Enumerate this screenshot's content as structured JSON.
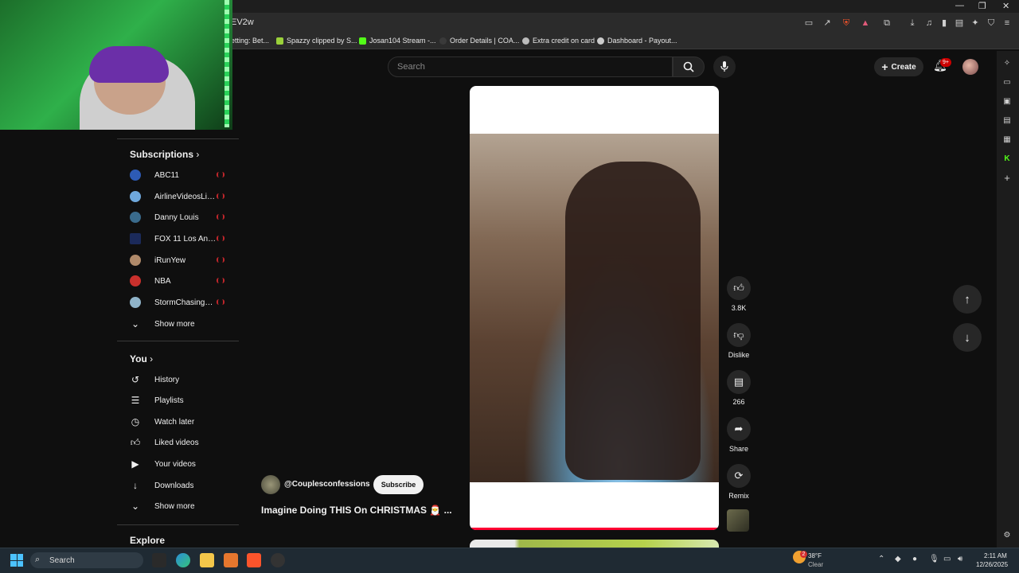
{
  "browser": {
    "url_fragment": "EV2w",
    "bookmarks": [
      {
        "label": "etting: Bet...",
        "color": "#888888"
      },
      {
        "label": "Spazzy clipped by S...",
        "color": "#9ad13a"
      },
      {
        "label": "Josan104 Stream -...",
        "color": "#53fc18"
      },
      {
        "label": "Order Details | COA...",
        "color": "#3a3a3a"
      },
      {
        "label": "Extra credit on card",
        "color": "#bbbbbb"
      },
      {
        "label": "Dashboard - Payout...",
        "color": "#cccccc"
      }
    ]
  },
  "header": {
    "search_placeholder": "Search",
    "create_label": "Create",
    "notification_count": "9+"
  },
  "sidebar": {
    "subscriptions_heading": "Subscriptions",
    "subscriptions": [
      {
        "label": "ABC11",
        "color": "#2d5bb5"
      },
      {
        "label": "AirlineVideosLive+",
        "color": "#6fa8dc"
      },
      {
        "label": "Danny Louis",
        "color": "#3a6b8c"
      },
      {
        "label": "FOX 11 Los Ang...",
        "color": "#1b2a5a"
      },
      {
        "label": "iRunYew",
        "color": "#b08a6a"
      },
      {
        "label": "NBA",
        "color": "#c9302c"
      },
      {
        "label": "StormChasingVi...",
        "color": "#8fb3c9"
      }
    ],
    "show_more_1": "Show more",
    "you_heading": "You",
    "you_items": [
      {
        "label": "History",
        "icon": "history-icon",
        "glyph": "↺"
      },
      {
        "label": "Playlists",
        "icon": "playlist-icon",
        "glyph": "☰"
      },
      {
        "label": "Watch later",
        "icon": "clock-icon",
        "glyph": "◷"
      },
      {
        "label": "Liked videos",
        "icon": "thumbs-up-icon",
        "glyph": "👍"
      },
      {
        "label": "Your videos",
        "icon": "video-icon",
        "glyph": "▶"
      },
      {
        "label": "Downloads",
        "icon": "download-icon",
        "glyph": "↓"
      }
    ],
    "show_more_2": "Show more",
    "explore_heading": "Explore"
  },
  "short": {
    "channel": "@Couplesconfessions",
    "subscribe_label": "Subscribe",
    "title": "Imagine Doing THIS On CHRISTMAS 🎅 ...",
    "likes": "3.8K",
    "dislike_label": "Dislike",
    "comments": "266",
    "share_label": "Share",
    "remix_label": "Remix"
  },
  "taskbar": {
    "search_placeholder": "Search",
    "weather_temp": "38°F",
    "weather_cond": "Clear",
    "weather_badge": "2",
    "time": "2:11 AM",
    "date": "12/26/2025"
  },
  "colors": {
    "live_indicator": "#c0262b",
    "progress": "#ff0033",
    "badge": "#cc0000"
  }
}
